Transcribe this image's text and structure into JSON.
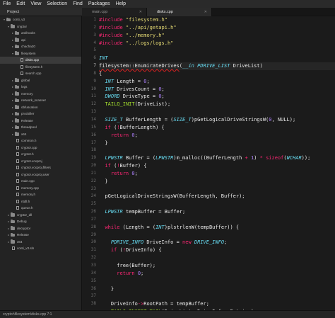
{
  "menu": [
    "File",
    "Edit",
    "View",
    "Selection",
    "Find",
    "Packages",
    "Help"
  ],
  "panel_title": "Project",
  "tabs": [
    {
      "label": "main.cpp",
      "active": false
    },
    {
      "label": "disks.cpp",
      "active": true
    }
  ],
  "tree": [
    {
      "label": "conti_v3",
      "type": "folder",
      "open": true
    },
    {
      "label": "cryptor",
      "type": "folder",
      "open": true
    },
    {
      "label": "antihooks",
      "type": "folder",
      "open": false
    },
    {
      "label": "api",
      "type": "folder",
      "open": false
    },
    {
      "label": "chacha20",
      "type": "folder",
      "open": false
    },
    {
      "label": "filesystem",
      "type": "folder",
      "open": true
    },
    {
      "label": "disks.cpp",
      "type": "file",
      "selected": true
    },
    {
      "label": "filesystem.h",
      "type": "file"
    },
    {
      "label": "search.cpp",
      "type": "file"
    },
    {
      "label": "global",
      "type": "folder",
      "open": false
    },
    {
      "label": "logs",
      "type": "folder",
      "open": false
    },
    {
      "label": "memory",
      "type": "folder",
      "open": false
    },
    {
      "label": "network_scanner",
      "type": "folder",
      "open": false
    },
    {
      "label": "obfuscation",
      "type": "folder",
      "open": false
    },
    {
      "label": "prockiller",
      "type": "folder",
      "open": false
    },
    {
      "label": "Release",
      "type": "folder",
      "open": false
    },
    {
      "label": "threadpool",
      "type": "folder",
      "open": false
    },
    {
      "label": "x64",
      "type": "folder",
      "open": false
    },
    {
      "label": "common.h",
      "type": "file"
    },
    {
      "label": "cryptor.cpp",
      "type": "file"
    },
    {
      "label": "cryptor.h",
      "type": "file"
    },
    {
      "label": "cryptor.vcxproj",
      "type": "file"
    },
    {
      "label": "cryptor.vcxproj.filters",
      "type": "file"
    },
    {
      "label": "cryptor.vcxproj.user",
      "type": "file"
    },
    {
      "label": "main.cpp",
      "type": "file"
    },
    {
      "label": "memory.cpp",
      "type": "file"
    },
    {
      "label": "memory.h",
      "type": "file"
    },
    {
      "label": "ntdll.h",
      "type": "file"
    },
    {
      "label": "queue.h",
      "type": "file"
    },
    {
      "label": "cryptor_dll",
      "type": "folder",
      "open": false
    },
    {
      "label": "Debug",
      "type": "folder",
      "open": false
    },
    {
      "label": "decryptor",
      "type": "folder",
      "open": false
    },
    {
      "label": "Release",
      "type": "folder",
      "open": false
    },
    {
      "label": "x64",
      "type": "folder",
      "open": false
    },
    {
      "label": "conti_v3.sln",
      "type": "file"
    }
  ],
  "line_numbers": [
    "1",
    "2",
    "3",
    "4",
    "5",
    "6",
    "7",
    "8",
    "9",
    "10",
    "11",
    "12",
    "13",
    "14",
    "15",
    "16",
    "17",
    "18",
    "19",
    "20",
    "21",
    "22",
    "23",
    "24",
    "25",
    "26",
    "27",
    "28",
    "29",
    "30",
    "31",
    "32",
    "33",
    "34",
    "35",
    "36",
    "37",
    "38"
  ],
  "current_line": 7,
  "code": [
    [
      [
        "pp",
        "#include "
      ],
      [
        "str",
        "\"filesystem.h\""
      ]
    ],
    [
      [
        "pp",
        "#include "
      ],
      [
        "str",
        "\"../api/getapi.h\""
      ]
    ],
    [
      [
        "pp",
        "#include "
      ],
      [
        "str",
        "\"../memory.h\""
      ]
    ],
    [
      [
        "pp",
        "#include "
      ],
      [
        "str",
        "\"../logs/logs.h\""
      ]
    ],
    [],
    [
      [
        "type",
        "INT"
      ]
    ],
    [
      [
        "sq",
        "filesystem::EnumirateDrives"
      ],
      [
        "var",
        "("
      ],
      [
        "type",
        "__in"
      ],
      [
        "var",
        " "
      ],
      [
        "type",
        "PDRIVE_LIST"
      ],
      [
        "var",
        " DriveList)"
      ]
    ],
    [
      [
        "var",
        "{"
      ]
    ],
    [
      [
        "var",
        "  "
      ],
      [
        "type",
        "INT"
      ],
      [
        "var",
        " Length = "
      ],
      [
        "num",
        "0"
      ],
      [
        "var",
        ";"
      ]
    ],
    [
      [
        "var",
        "  "
      ],
      [
        "type",
        "INT"
      ],
      [
        "var",
        " DrivesCount = "
      ],
      [
        "num",
        "0"
      ],
      [
        "var",
        ";"
      ]
    ],
    [
      [
        "var",
        "  "
      ],
      [
        "type",
        "DWORD"
      ],
      [
        "var",
        " DriveType = "
      ],
      [
        "num",
        "0"
      ],
      [
        "var",
        ";"
      ]
    ],
    [
      [
        "var",
        "  "
      ],
      [
        "fn",
        "TAILQ_INIT"
      ],
      [
        "var",
        "(DriveList);"
      ]
    ],
    [],
    [
      [
        "var",
        "  "
      ],
      [
        "type",
        "SIZE_T"
      ],
      [
        "var",
        " BufferLength = ("
      ],
      [
        "type",
        "SIZE_T"
      ],
      [
        "var",
        ")pGetLogicalDriveStringsW("
      ],
      [
        "num",
        "0"
      ],
      [
        "var",
        ", NULL);"
      ]
    ],
    [
      [
        "var",
        "  "
      ],
      [
        "kw",
        "if"
      ],
      [
        "var",
        " ("
      ],
      [
        "op",
        "!"
      ],
      [
        "var",
        "BufferLength) {"
      ]
    ],
    [
      [
        "var",
        "    "
      ],
      [
        "kw",
        "return"
      ],
      [
        "var",
        " "
      ],
      [
        "num",
        "0"
      ],
      [
        "var",
        ";"
      ]
    ],
    [
      [
        "var",
        "  }"
      ]
    ],
    [],
    [
      [
        "var",
        "  "
      ],
      [
        "type",
        "LPWSTR"
      ],
      [
        "var",
        " Buffer = ("
      ],
      [
        "type",
        "LPWSTR"
      ],
      [
        "var",
        ")m_malloc((BufferLength "
      ],
      [
        "op",
        "+"
      ],
      [
        "var",
        " "
      ],
      [
        "num",
        "1"
      ],
      [
        "var",
        ") "
      ],
      [
        "op",
        "*"
      ],
      [
        "var",
        " "
      ],
      [
        "kw",
        "sizeof"
      ],
      [
        "var",
        "("
      ],
      [
        "type",
        "WCHAR"
      ],
      [
        "var",
        "));"
      ]
    ],
    [
      [
        "var",
        "  "
      ],
      [
        "kw",
        "if"
      ],
      [
        "var",
        " ("
      ],
      [
        "op",
        "!"
      ],
      [
        "var",
        "Buffer) {"
      ]
    ],
    [
      [
        "var",
        "    "
      ],
      [
        "kw",
        "return"
      ],
      [
        "var",
        " "
      ],
      [
        "num",
        "0"
      ],
      [
        "var",
        ";"
      ]
    ],
    [
      [
        "var",
        "  }"
      ]
    ],
    [],
    [
      [
        "var",
        "  pGetLogicalDriveStringsW(BufferLength, Buffer);"
      ]
    ],
    [],
    [
      [
        "var",
        "  "
      ],
      [
        "type",
        "LPWSTR"
      ],
      [
        "var",
        " tempBuffer = Buffer;"
      ]
    ],
    [],
    [
      [
        "var",
        "  "
      ],
      [
        "kw",
        "while"
      ],
      [
        "var",
        " (Length = ("
      ],
      [
        "type",
        "INT"
      ],
      [
        "var",
        ")plstrlenW(tempBuffer)) {"
      ]
    ],
    [],
    [
      [
        "var",
        "    "
      ],
      [
        "type",
        "PDRIVE_INFO"
      ],
      [
        "var",
        " DriveInfo = "
      ],
      [
        "kw",
        "new"
      ],
      [
        "var",
        " "
      ],
      [
        "type",
        "DRIVE_INFO"
      ],
      [
        "var",
        ";"
      ]
    ],
    [
      [
        "var",
        "    "
      ],
      [
        "kw",
        "if"
      ],
      [
        "var",
        " ("
      ],
      [
        "op",
        "!"
      ],
      [
        "var",
        "DriveInfo) {"
      ]
    ],
    [],
    [
      [
        "var",
        "      free(Buffer);"
      ]
    ],
    [
      [
        "var",
        "      "
      ],
      [
        "kw",
        "return"
      ],
      [
        "var",
        " "
      ],
      [
        "num",
        "0"
      ],
      [
        "var",
        ";"
      ]
    ],
    [],
    [
      [
        "var",
        "    }"
      ]
    ],
    [],
    [
      [
        "var",
        "    DriveInfo"
      ],
      [
        "op",
        "->"
      ],
      [
        "var",
        "RootPath = tempBuffer;"
      ]
    ],
    [
      [
        "var",
        "    "
      ],
      [
        "fn",
        "TAILQ_INSERT_TAIL"
      ],
      [
        "var",
        "(DriveList, DriveInfo, Entries);"
      ]
    ]
  ],
  "status": "cryptor\\filesystem\\disks.cpp   7:1"
}
